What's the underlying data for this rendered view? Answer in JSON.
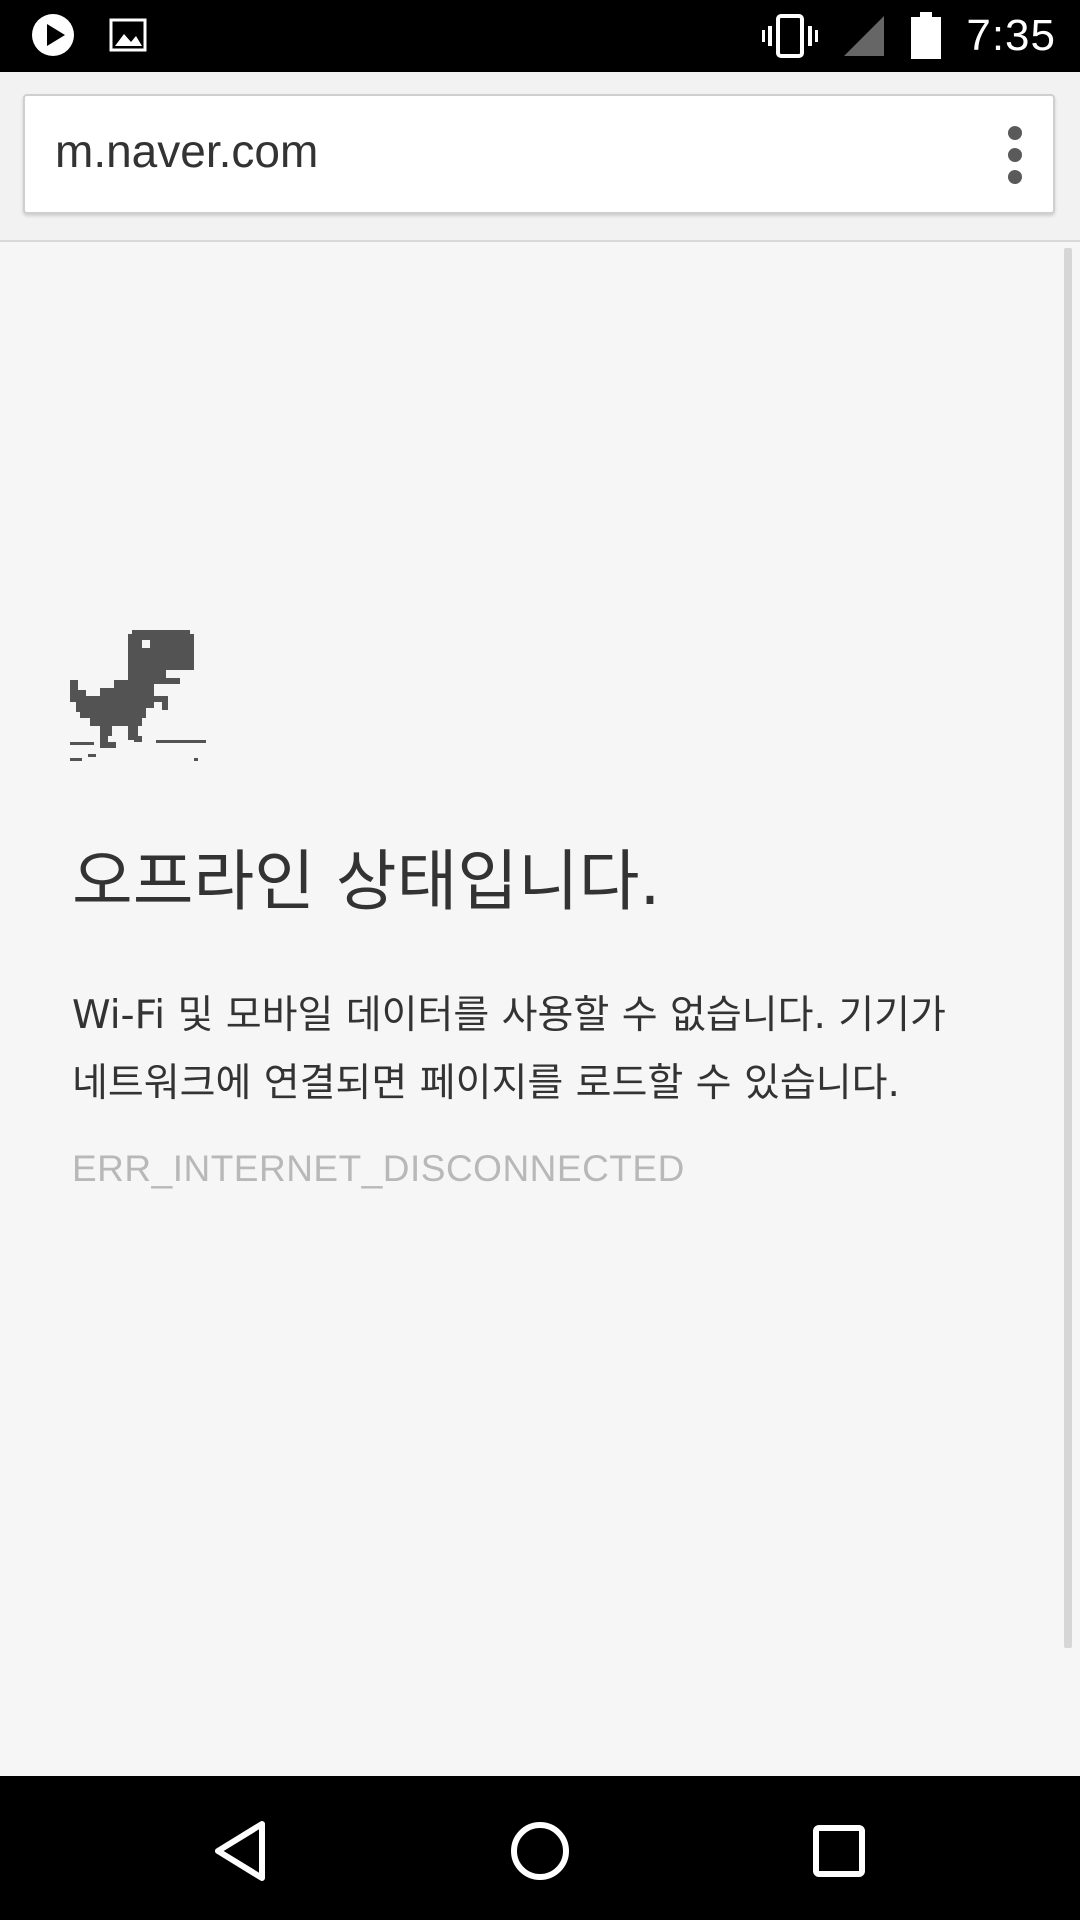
{
  "status_bar": {
    "time": "7:35",
    "icons": [
      "play-notification-icon",
      "image-notification-icon",
      "vibrate-icon",
      "signal-icon",
      "battery-icon"
    ]
  },
  "toolbar": {
    "url": "m.naver.com",
    "menu_icon": "overflow-menu-icon"
  },
  "error_page": {
    "illustration": "offline-dino-icon",
    "title": "오프라인 상태입니다.",
    "description_line1": "Wi-Fi 및 모바일 데이터를 사용할 수 없습니다. 기기가",
    "description_line2": "네트워크에 연결되면 페이지를 로드할 수 있습니다.",
    "error_code": "ERR_INTERNET_DISCONNECTED"
  },
  "nav_bar": {
    "buttons": [
      "back-icon",
      "home-icon",
      "recents-icon"
    ]
  },
  "colors": {
    "status_bar_bg": "#000000",
    "page_bg": "#f6f6f6",
    "text": "#333333",
    "error_code_text": "#b8b8b8"
  }
}
